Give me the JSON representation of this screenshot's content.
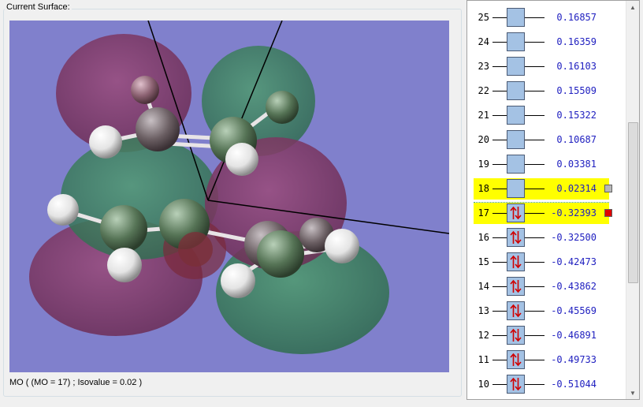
{
  "surface_group": {
    "title": "Current Surface:",
    "status": "MO ( (MO = 17) ; Isovalue = 0.02 )"
  },
  "orbitals": [
    {
      "n": "25",
      "energy": " 0.16857",
      "occupied": false
    },
    {
      "n": "24",
      "energy": " 0.16359",
      "occupied": false
    },
    {
      "n": "23",
      "energy": " 0.16103",
      "occupied": false
    },
    {
      "n": "22",
      "energy": " 0.15509",
      "occupied": false
    },
    {
      "n": "21",
      "energy": " 0.15322",
      "occupied": false
    },
    {
      "n": "20",
      "energy": " 0.10687",
      "occupied": false
    },
    {
      "n": "19",
      "energy": " 0.03381",
      "occupied": false
    },
    {
      "n": "18",
      "energy": " 0.02314",
      "occupied": false,
      "highlight": true,
      "marker": "#b8b8b8"
    },
    {
      "n": "17",
      "energy": "-0.32393",
      "occupied": true,
      "highlight": true,
      "marker": "#e00000"
    },
    {
      "n": "16",
      "energy": "-0.32500",
      "occupied": true
    },
    {
      "n": "15",
      "energy": "-0.42473",
      "occupied": true
    },
    {
      "n": "14",
      "energy": "-0.43862",
      "occupied": true
    },
    {
      "n": "13",
      "energy": "-0.45569",
      "occupied": true
    },
    {
      "n": "12",
      "energy": "-0.46891",
      "occupied": true
    },
    {
      "n": "11",
      "energy": "-0.49733",
      "occupied": true
    },
    {
      "n": "10",
      "energy": "-0.51044",
      "occupied": true
    }
  ],
  "scrollbar": {
    "up_icon": "triangle-up",
    "down_icon": "triangle-down"
  },
  "colors": {
    "viewer_bg": "#8080cc",
    "lobe_positive": "#3f8f5f",
    "lobe_negative": "#8a3a6a",
    "highlight": "#ffff00",
    "energy_text": "#2020c0"
  }
}
